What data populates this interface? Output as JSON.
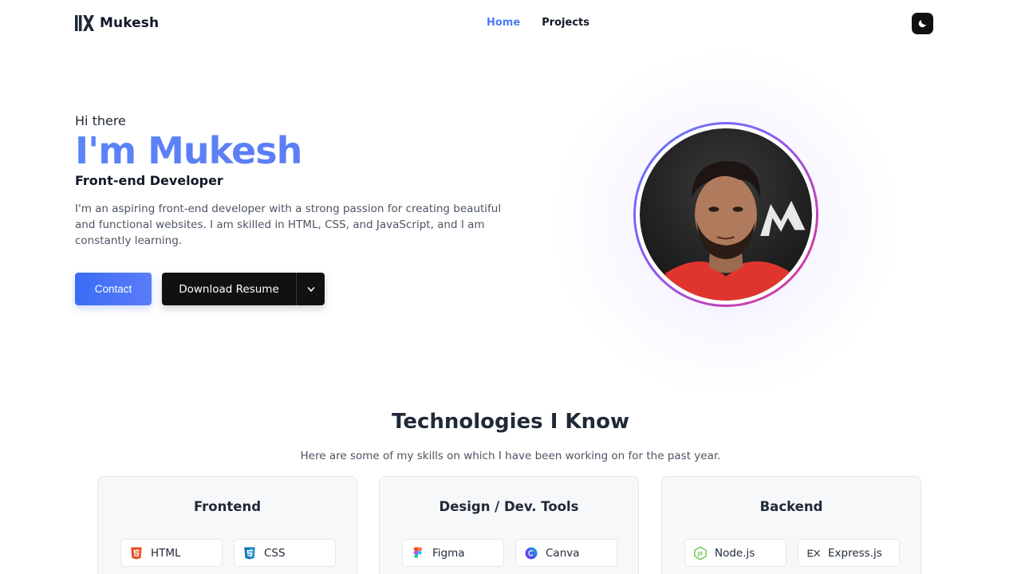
{
  "nav": {
    "logo_text": "Mukesh",
    "links": [
      {
        "label": "Home",
        "active": true
      },
      {
        "label": "Projects",
        "active": false
      }
    ],
    "theme_toggle_icon": "moon-icon"
  },
  "hero": {
    "greeting": "Hi there",
    "name": "I'm Mukesh",
    "role": "Front-end Developer",
    "bio": "I'm an aspiring front-end developer with a strong passion for creating beautiful and functional websites. I am skilled in HTML, CSS, and JavaScript, and I am constantly learning.",
    "contact_label": "Contact",
    "resume_label": "Download Resume",
    "resume_dropdown_icon": "chevron-down-icon",
    "avatar": "profile-photo"
  },
  "technologies": {
    "title": "Technologies I Know",
    "subtitle": "Here are some of my skills on which I have been working on for the past year.",
    "categories": [
      {
        "title": "Frontend",
        "items": [
          {
            "label": "HTML",
            "icon": "html5-icon"
          },
          {
            "label": "CSS",
            "icon": "css3-icon"
          }
        ]
      },
      {
        "title": "Design / Dev. Tools",
        "items": [
          {
            "label": "Figma",
            "icon": "figma-icon"
          },
          {
            "label": "Canva",
            "icon": "canva-icon"
          }
        ]
      },
      {
        "title": "Backend",
        "items": [
          {
            "label": "Node.js",
            "icon": "nodejs-icon"
          },
          {
            "label": "Express.js",
            "icon": "express-icon"
          }
        ]
      }
    ]
  },
  "colors": {
    "accent": "#4f7cf7",
    "dark": "#111111",
    "card_bg": "#f7f8fa"
  }
}
